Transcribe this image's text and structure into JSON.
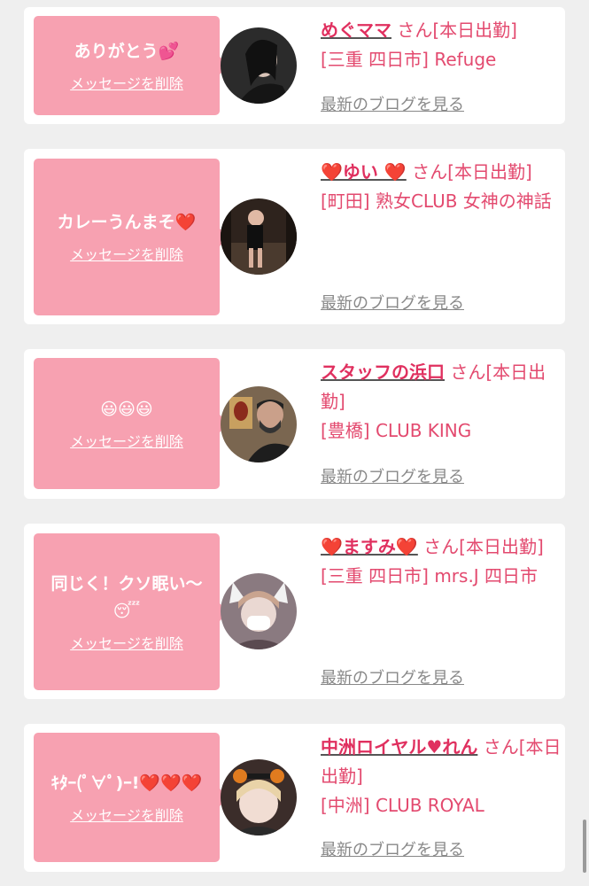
{
  "cards": [
    {
      "message": "ありがとう💕",
      "delete_label": "メッセージを削除",
      "name": "めぐママ",
      "suffix": " さん[本日出勤]",
      "location": "[三重 四日市] Refuge",
      "blog_label": "最新のブログを見る",
      "avatar_bg": "#2b2b2b"
    },
    {
      "message": "カレーうんまそ❤️",
      "delete_label": "メッセージを削除",
      "name": "❤️ゆい ❤️",
      "suffix": " さん[本日出勤]",
      "location": "[町田] 熟女CLUB 女神の神話",
      "blog_label": "最新のブログを見る",
      "avatar_bg": "#3a2a22"
    },
    {
      "message": "😃😃😃",
      "delete_label": "メッセージを削除",
      "name": "スタッフの浜口",
      "suffix": " さん[本日出勤]",
      "location": "[豊橋] CLUB KING",
      "blog_label": "最新のブログを見る",
      "avatar_bg": "#6b5a44"
    },
    {
      "message": "同じく！クソ眠い〜😴",
      "delete_label": "メッセージを削除",
      "name": "❤️ますみ❤️",
      "suffix": " さん[本日出勤]",
      "location": "[三重 四日市] mrs.J 四日市",
      "blog_label": "最新のブログを見る",
      "avatar_bg": "#8a7a80"
    },
    {
      "message": "ｷﾀｰ(ﾟ∀ﾟ)ｰ!❤️❤️❤️",
      "delete_label": "メッセージを削除",
      "name": "中洲ロイヤル♥れん",
      "suffix": " さん[本日出勤]",
      "location": "[中洲] CLUB ROYAL",
      "blog_label": "最新のブログを見る",
      "avatar_bg": "#3b2d2a"
    }
  ],
  "colors": {
    "accent": "#e0305f",
    "bubble": "#f7a1b1",
    "background": "#efefef"
  }
}
